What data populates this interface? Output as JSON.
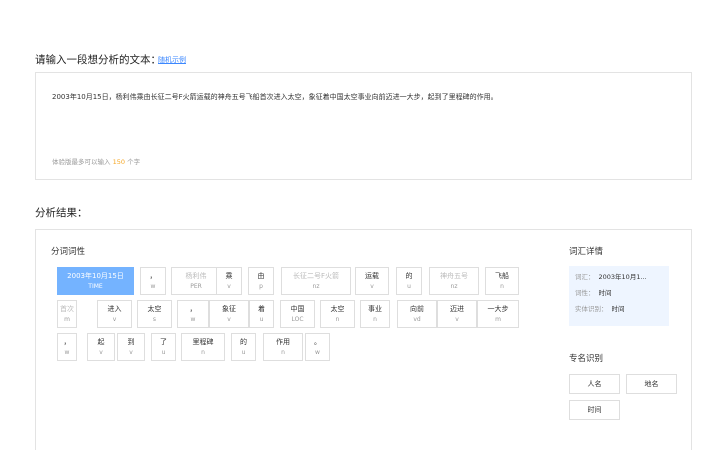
{
  "input": {
    "title": "请输入一段想分析的文本：",
    "random_link": "随机示例",
    "text": "2003年10月15日，杨利伟乘由长征二号F火箭运载的神舟五号飞船首次进入太空，象征着中国太空事业向前迈进一大步，起到了里程碑的作用。",
    "limit_prefix": "体验版最多可以输入",
    "limit_number": "150",
    "limit_suffix": "个字"
  },
  "result": {
    "title": "分析结果：",
    "segmentation_title": "分词词性",
    "rows": [
      [
        {
          "word": "2003年10月15日",
          "pos": "TIME",
          "selected": true
        },
        {
          "word": "，",
          "pos": "w"
        },
        {
          "word": "杨利伟",
          "pos": "PER",
          "blurred": true
        },
        {
          "word": "乘",
          "pos": "v"
        },
        {
          "word": "由",
          "pos": "p"
        },
        {
          "word": "长征二号F火箭",
          "pos": "nz",
          "blurred": true
        },
        {
          "word": "运载",
          "pos": "v"
        },
        {
          "word": "的",
          "pos": "u"
        },
        {
          "word": "神舟五号",
          "pos": "nz",
          "blurred": true
        },
        {
          "word": "飞船",
          "pos": "n"
        }
      ],
      [
        {
          "word": "首次",
          "pos": "m",
          "blurred": true
        },
        {
          "word": "进入",
          "pos": "v"
        },
        {
          "word": "太空",
          "pos": "s"
        },
        {
          "word": "，",
          "pos": "w"
        },
        {
          "word": "象征",
          "pos": "v"
        },
        {
          "word": "着",
          "pos": "u"
        },
        {
          "word": "中国",
          "pos": "LOC"
        },
        {
          "word": "太空",
          "pos": "n"
        },
        {
          "word": "事业",
          "pos": "n"
        },
        {
          "word": "向前",
          "pos": "vd"
        },
        {
          "word": "迈进",
          "pos": "v"
        },
        {
          "word": "一大步",
          "pos": "m"
        }
      ],
      [
        {
          "word": "，",
          "pos": "w"
        },
        {
          "word": "起",
          "pos": "v"
        },
        {
          "word": "到",
          "pos": "v"
        },
        {
          "word": "了",
          "pos": "u"
        },
        {
          "word": "里程碑",
          "pos": "n"
        },
        {
          "word": "的",
          "pos": "u"
        },
        {
          "word": "作用",
          "pos": "n"
        },
        {
          "word": "。",
          "pos": "w"
        }
      ]
    ],
    "detail": {
      "title": "词汇详情",
      "rows": [
        {
          "key": "词汇：",
          "value": "2003年10月1..."
        },
        {
          "key": "词性：",
          "value": "时间"
        },
        {
          "key": "实体识别：",
          "value": "时间"
        }
      ]
    },
    "ner": {
      "title": "专名识别",
      "buttons": [
        "人名",
        "地名",
        "时间"
      ]
    }
  },
  "colors": {
    "accent": "#3b87ff",
    "selected_token": "#74b3ff",
    "detail_bg": "#eef5ff",
    "limit_number": "#f5a623"
  }
}
